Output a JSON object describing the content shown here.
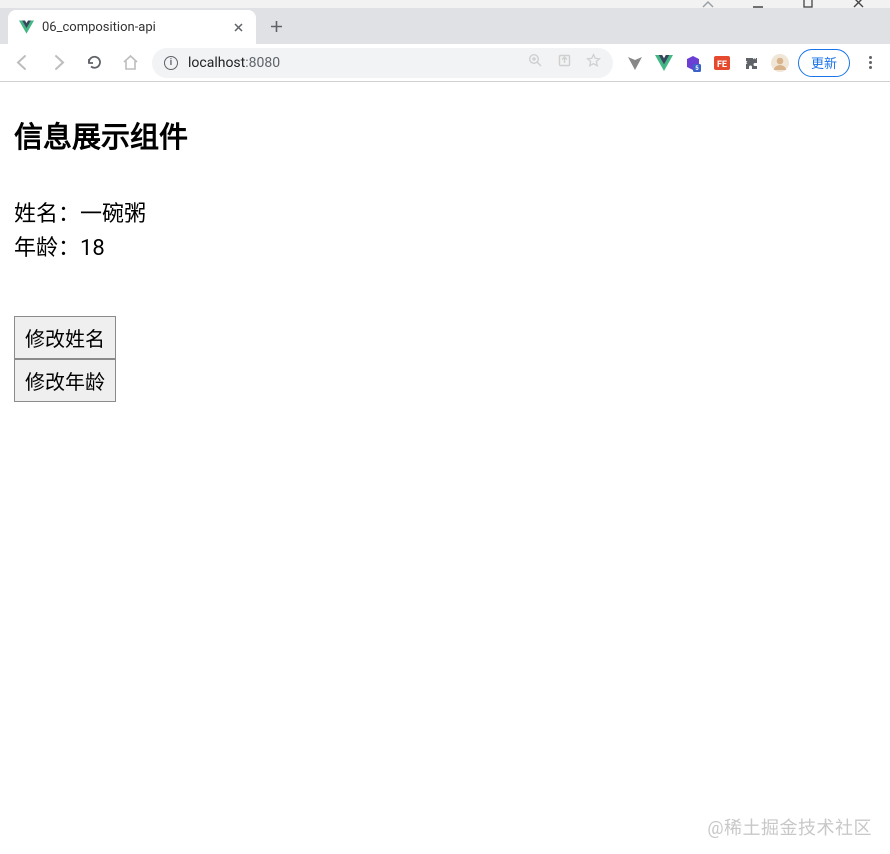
{
  "window": {
    "tab_title": "06_composition-api"
  },
  "toolbar": {
    "url_host": "localhost",
    "url_port": ":8080",
    "update_label": "更新"
  },
  "page": {
    "heading": "信息展示组件",
    "name_label": "姓名：",
    "name_value": "一碗粥",
    "age_label": "年龄：",
    "age_value": "18",
    "edit_name_btn": "修改姓名",
    "edit_age_btn": "修改年龄"
  },
  "watermark": "@稀土掘金技术社区"
}
